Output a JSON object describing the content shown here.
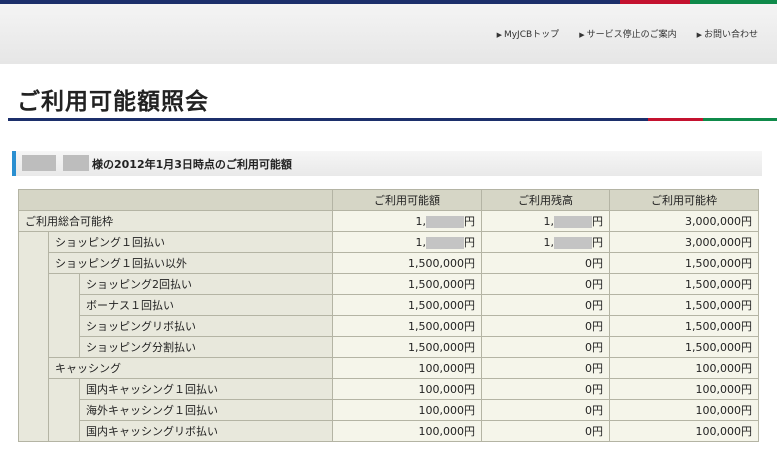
{
  "header": {
    "nav": [
      {
        "label": "MyJCBトップ"
      },
      {
        "label": "サービス停止のご案内"
      },
      {
        "label": "お問い合わせ"
      }
    ]
  },
  "page_title": "ご利用可能額照会",
  "section": {
    "title_suffix": "様の2012年1月3日時点のご利用可能額"
  },
  "table": {
    "columns": [
      "ご利用可能額",
      "ご利用残高",
      "ご利用可能枠"
    ],
    "rows": [
      {
        "label": "ご利用総合可能枠",
        "level": 0,
        "available_prefix": "1,",
        "available_suffix": "円",
        "balance_prefix": "1,",
        "balance_suffix": "円",
        "limit": "3,000,000円",
        "masked": true
      },
      {
        "label": "ショッピング１回払い",
        "level": 1,
        "available_prefix": "1,",
        "available_suffix": "円",
        "balance_prefix": "1,",
        "balance_suffix": "円",
        "limit": "3,000,000円",
        "masked": true
      },
      {
        "label": "ショッピング１回払い以外",
        "level": 1,
        "available": "1,500,000円",
        "balance": "0円",
        "limit": "1,500,000円"
      },
      {
        "label": "ショッピング2回払い",
        "level": 2,
        "available": "1,500,000円",
        "balance": "0円",
        "limit": "1,500,000円"
      },
      {
        "label": "ボーナス１回払い",
        "level": 2,
        "available": "1,500,000円",
        "balance": "0円",
        "limit": "1,500,000円"
      },
      {
        "label": "ショッピングリボ払い",
        "level": 2,
        "available": "1,500,000円",
        "balance": "0円",
        "limit": "1,500,000円"
      },
      {
        "label": "ショッピング分割払い",
        "level": 2,
        "available": "1,500,000円",
        "balance": "0円",
        "limit": "1,500,000円"
      },
      {
        "label": "キャッシング",
        "level": 1,
        "available": "100,000円",
        "balance": "0円",
        "limit": "100,000円"
      },
      {
        "label": "国内キャッシング１回払い",
        "level": 2,
        "available": "100,000円",
        "balance": "0円",
        "limit": "100,000円"
      },
      {
        "label": "海外キャッシング１回払い",
        "level": 2,
        "available": "100,000円",
        "balance": "0円",
        "limit": "100,000円"
      },
      {
        "label": "国内キャッシングリボ払い",
        "level": 2,
        "available": "100,000円",
        "balance": "0円",
        "limit": "100,000円"
      }
    ]
  }
}
